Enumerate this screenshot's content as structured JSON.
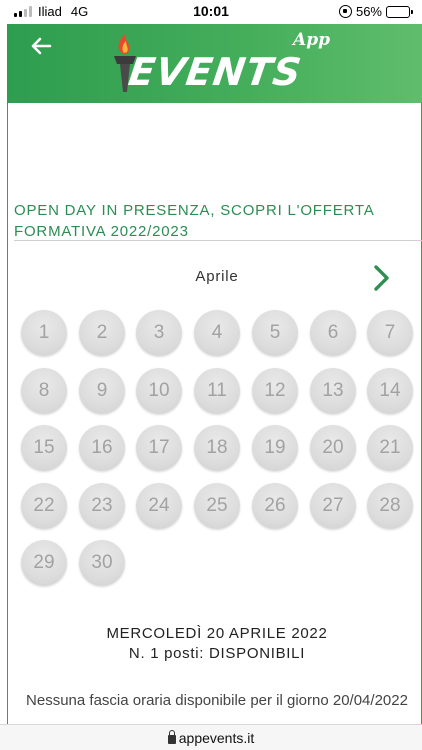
{
  "status_bar": {
    "carrier": "Iliad",
    "network": "4G",
    "time": "10:01",
    "battery": "56%",
    "battery_level": 0.56
  },
  "header": {
    "back_icon": "back-arrow-icon",
    "logo_text": "EVENTS",
    "logo_app": "App",
    "brand_color": "#3ea955"
  },
  "event": {
    "title": "OPEN DAY IN PRESENZA, SCOPRI L'OFFERTA FORMATIVA 2022/2023"
  },
  "calendar": {
    "month": "Aprile",
    "next_icon": "chevron-right-icon",
    "days": [
      "1",
      "2",
      "3",
      "4",
      "5",
      "6",
      "7",
      "8",
      "9",
      "10",
      "11",
      "12",
      "13",
      "14",
      "15",
      "16",
      "17",
      "18",
      "19",
      "20",
      "21",
      "22",
      "23",
      "24",
      "25",
      "26",
      "27",
      "28",
      "29",
      "30"
    ]
  },
  "selection": {
    "date_line": "MERCOLEDÌ 20 APRILE 2022",
    "availability": "N. 1 posti: DISPONIBILI",
    "note": "Nessuna fascia oraria disponibile per il giorno 20/04/2022"
  },
  "browser": {
    "url": "appevents.it"
  }
}
